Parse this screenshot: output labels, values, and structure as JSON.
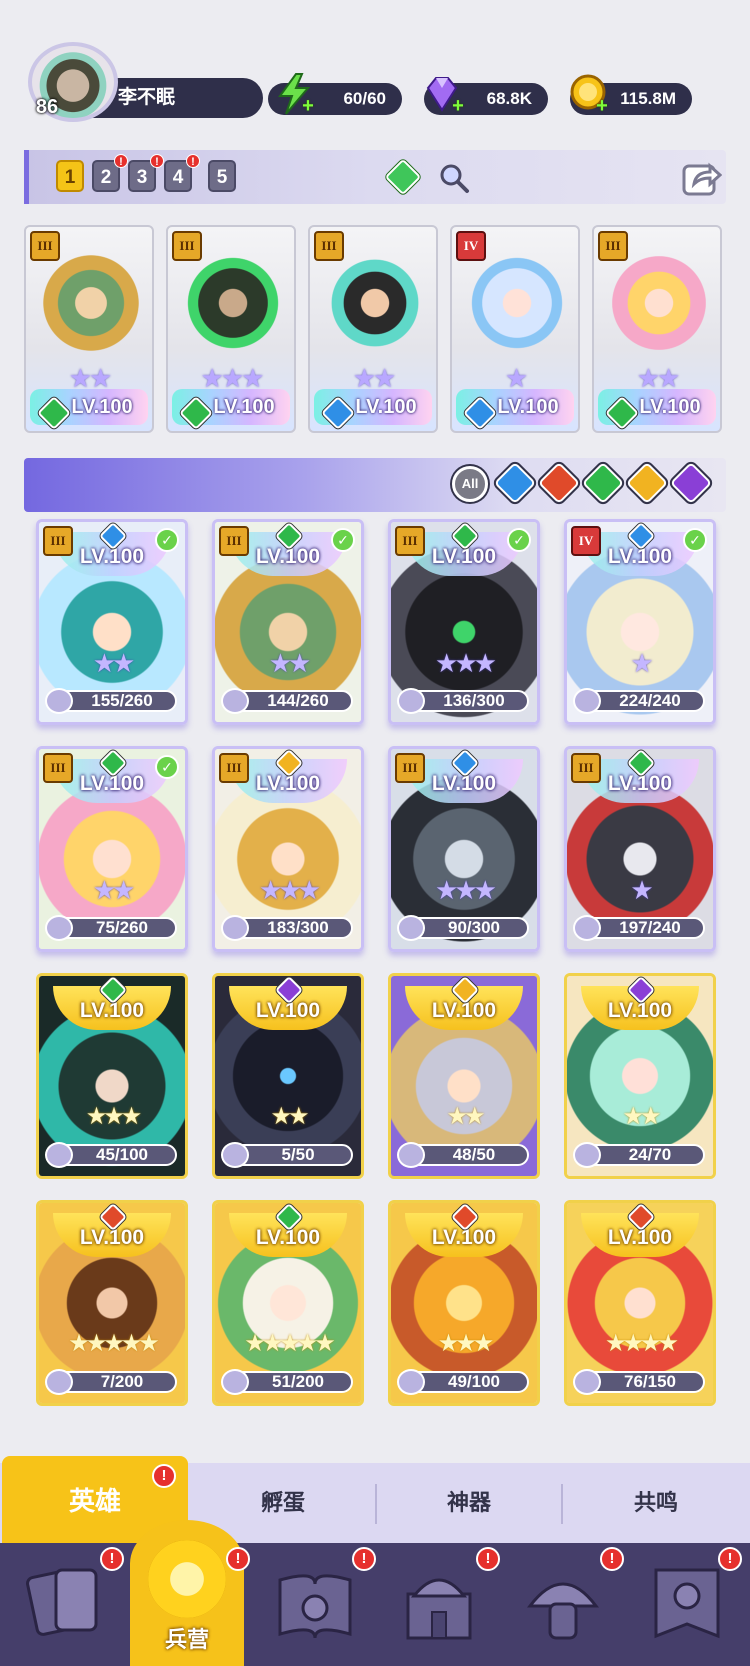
{
  "player": {
    "level": "86",
    "name": "李不眠"
  },
  "resources": {
    "energy": "60/60",
    "gems": "68.8K",
    "coins": "115.8M"
  },
  "team_slots": [
    "1",
    "2",
    "3",
    "4",
    "5"
  ],
  "team_cards": [
    {
      "rank": "III",
      "stars": "★★",
      "level": "LV.100",
      "element": "wind"
    },
    {
      "rank": "III",
      "stars": "★★★",
      "level": "LV.100",
      "element": "wind"
    },
    {
      "rank": "III",
      "stars": "★★",
      "level": "LV.100",
      "element": "water"
    },
    {
      "rank": "IV",
      "stars": "★",
      "level": "LV.100",
      "element": "water"
    },
    {
      "rank": "III",
      "stars": "★★",
      "level": "LV.100",
      "element": "wind"
    }
  ],
  "filters": {
    "all_label": "All",
    "elements": [
      "water",
      "fire",
      "wind",
      "light",
      "dark"
    ]
  },
  "heroes": [
    {
      "rank": "III",
      "level": "LV.100",
      "stars": "★★",
      "fragments": "155/260",
      "element": "water",
      "check": true,
      "tier": "purple"
    },
    {
      "rank": "III",
      "level": "LV.100",
      "stars": "★★",
      "fragments": "144/260",
      "element": "wind",
      "check": true,
      "tier": "purple"
    },
    {
      "rank": "III",
      "level": "LV.100",
      "stars": "★★★",
      "fragments": "136/300",
      "element": "wind",
      "check": true,
      "tier": "purple"
    },
    {
      "rank": "IV",
      "level": "LV.100",
      "stars": "★",
      "fragments": "224/240",
      "element": "water",
      "check": true,
      "tier": "purple"
    },
    {
      "rank": "III",
      "level": "LV.100",
      "stars": "★★",
      "fragments": "75/260",
      "element": "wind",
      "check": true,
      "tier": "purple"
    },
    {
      "rank": "III",
      "level": "LV.100",
      "stars": "★★★",
      "fragments": "183/300",
      "element": "light",
      "check": false,
      "tier": "purple"
    },
    {
      "rank": "III",
      "level": "LV.100",
      "stars": "★★★",
      "fragments": "90/300",
      "element": "water",
      "check": false,
      "tier": "purple"
    },
    {
      "rank": "III",
      "level": "LV.100",
      "stars": "★",
      "fragments": "197/240",
      "element": "wind",
      "check": false,
      "tier": "purple"
    },
    {
      "level": "LV.100",
      "stars": "★★★",
      "fragments": "45/100",
      "element": "wind",
      "tier": "gold"
    },
    {
      "level": "LV.100",
      "stars": "★★",
      "fragments": "5/50",
      "element": "dark",
      "tier": "gold"
    },
    {
      "level": "LV.100",
      "stars": "★★",
      "fragments": "48/50",
      "element": "light",
      "tier": "gold"
    },
    {
      "level": "LV.100",
      "stars": "★★",
      "fragments": "24/70",
      "element": "dark",
      "tier": "gold"
    },
    {
      "level": "LV.100",
      "stars": "★★★★★",
      "fragments": "7/200",
      "element": "fire",
      "tier": "gold"
    },
    {
      "level": "LV.100",
      "stars": "★★★★★",
      "fragments": "51/200",
      "element": "wind",
      "tier": "gold"
    },
    {
      "level": "LV.100",
      "stars": "★★★",
      "fragments": "49/100",
      "element": "fire",
      "tier": "gold"
    },
    {
      "level": "LV.100",
      "stars": "★★★★",
      "fragments": "76/150",
      "element": "fire",
      "tier": "gold"
    }
  ],
  "sub_tabs": [
    "英雄",
    "孵蛋",
    "神器",
    "共鸣"
  ],
  "nav": {
    "active_label": "兵营"
  },
  "notification_mark": "!",
  "colors": {
    "water": "#2f8fe6",
    "fire": "#e04a2a",
    "wind": "#2fb84a",
    "light": "#f1b321",
    "dark": "#8a3fd6",
    "accent": "#f7c318"
  }
}
